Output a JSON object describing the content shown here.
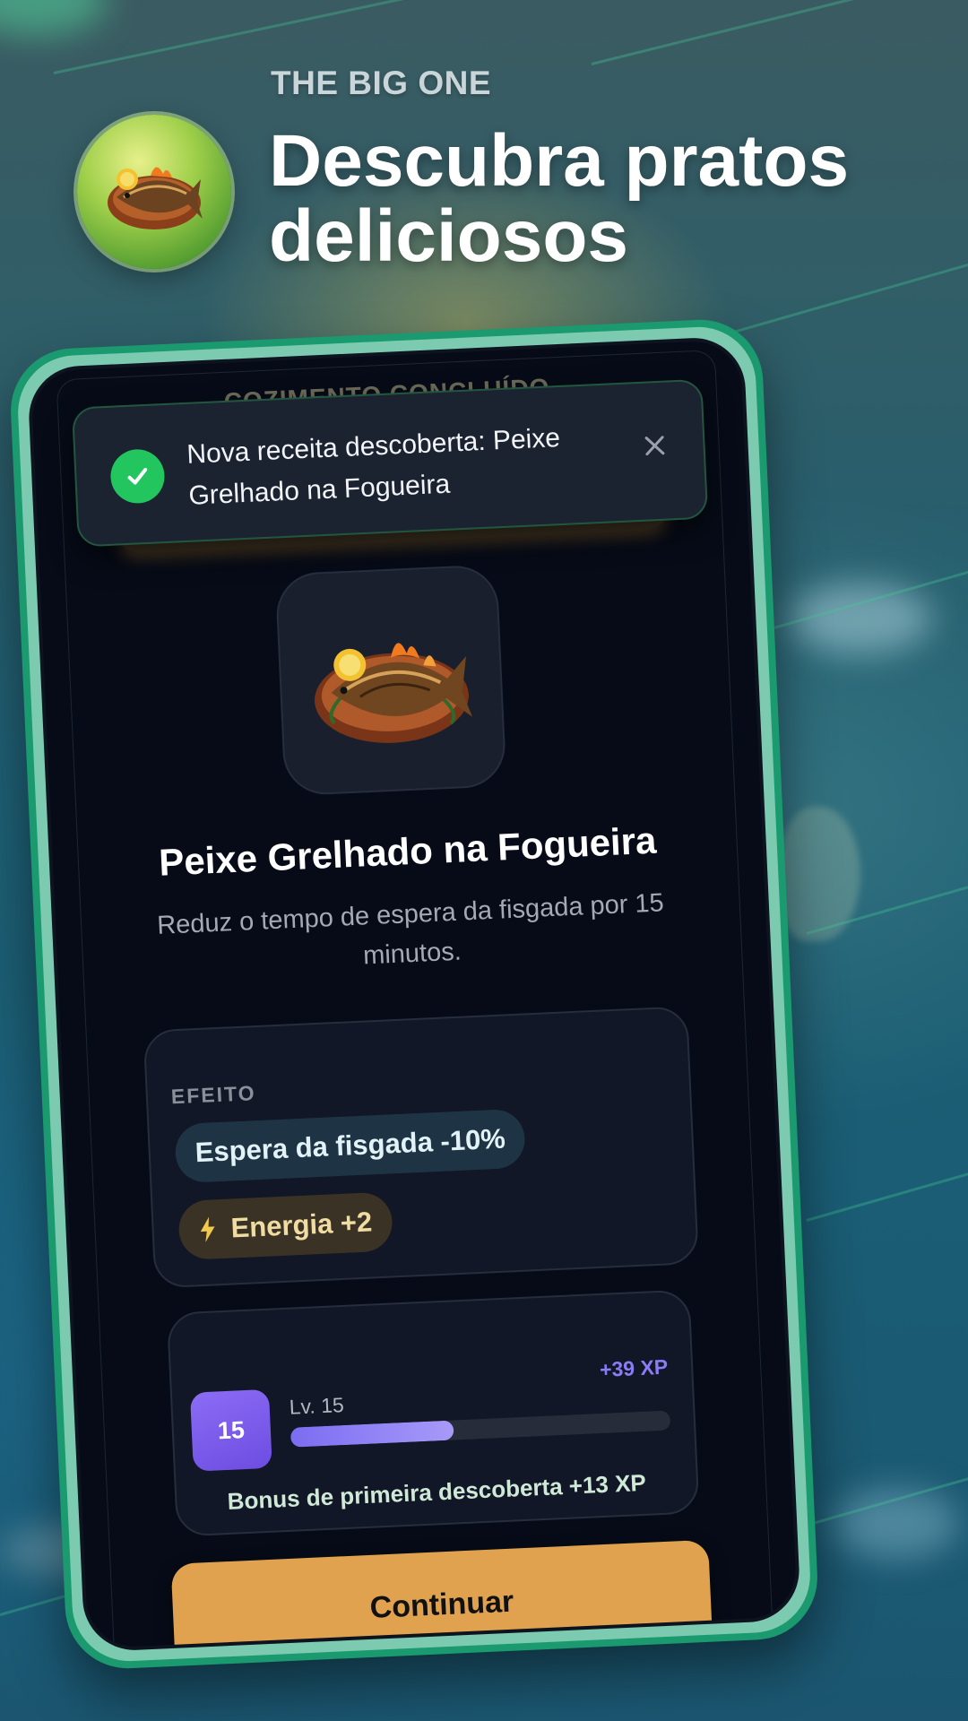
{
  "header": {
    "eyebrow": "THE BIG ONE",
    "headline": "Descubra pratos deliciosos",
    "icon": "grilled-fish-dish"
  },
  "screen": {
    "faded_title": "COZIMENTO CONCLUÍDO",
    "toast": {
      "message": "Nova receita descoberta: Peixe Grelhado na Fogueira",
      "icon": "check-icon",
      "close_icon": "close-icon"
    },
    "dish": {
      "image": "grilled-fish-dish",
      "name": "Peixe Grelhado na Fogueira",
      "description": "Reduz o tempo de espera da fisgada por 15 minutos."
    },
    "effects": {
      "label": "EFEITO",
      "items": [
        {
          "text": "Espera da fisgada -10%",
          "style": "teal"
        },
        {
          "text": "Energia +2",
          "style": "gold",
          "icon": "bolt-icon"
        }
      ]
    },
    "xp": {
      "level_badge": "15",
      "level_label": "Lv. 15",
      "gain": "+39 XP",
      "progress_fraction": 0.43,
      "bonus": "Bonus de primeira descoberta +13 XP"
    },
    "continue_label": "Continuar"
  },
  "colors": {
    "accent_green": "#22c55e",
    "phone_frame": "#1a9a6e",
    "button": "#e0a24e",
    "xp_purple": "#8b7cf6"
  }
}
